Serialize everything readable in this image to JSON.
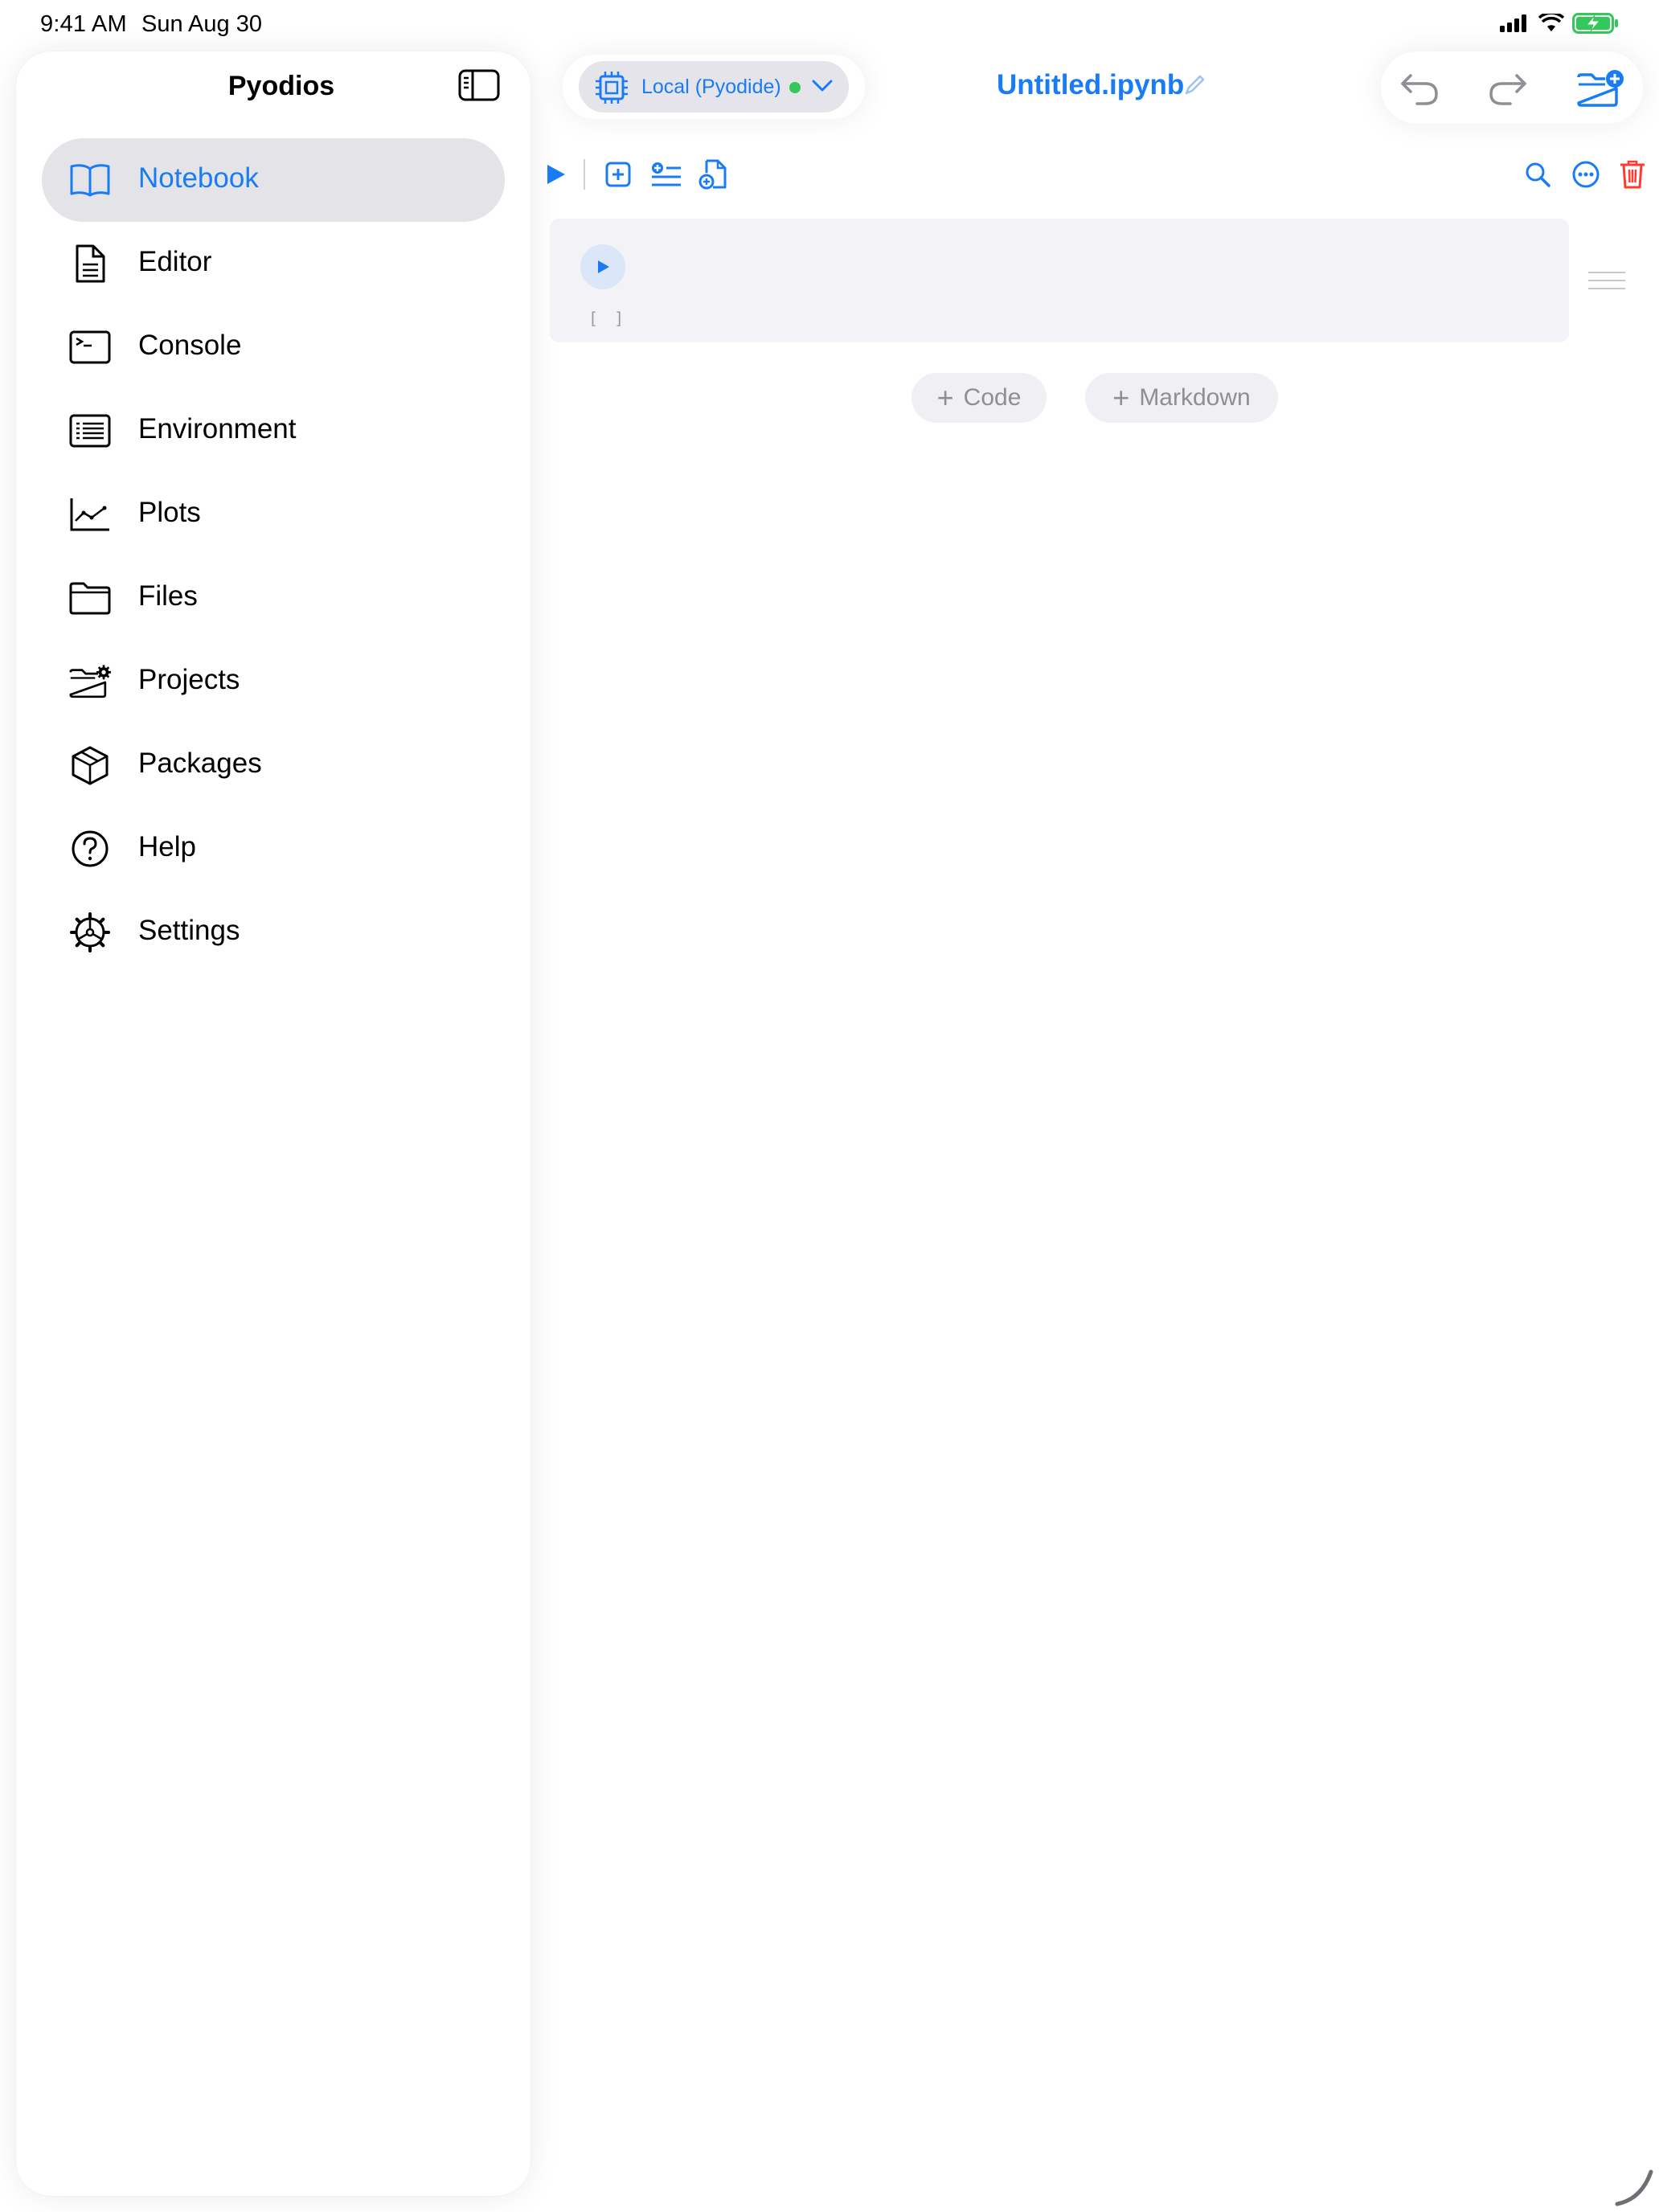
{
  "status_bar": {
    "time": "9:41 AM",
    "date": "Sun Aug 30"
  },
  "sidebar": {
    "title": "Pyodios",
    "items": [
      {
        "label": "Notebook",
        "icon": "book-icon",
        "selected": true
      },
      {
        "label": "Editor",
        "icon": "document-icon",
        "selected": false
      },
      {
        "label": "Console",
        "icon": "terminal-icon",
        "selected": false
      },
      {
        "label": "Environment",
        "icon": "list-icon",
        "selected": false
      },
      {
        "label": "Plots",
        "icon": "chart-icon",
        "selected": false
      },
      {
        "label": "Files",
        "icon": "folder-icon",
        "selected": false
      },
      {
        "label": "Projects",
        "icon": "folder-gear-icon",
        "selected": false
      },
      {
        "label": "Packages",
        "icon": "box-icon",
        "selected": false
      },
      {
        "label": "Help",
        "icon": "question-icon",
        "selected": false
      },
      {
        "label": "Settings",
        "icon": "gear-icon",
        "selected": false
      }
    ]
  },
  "kernel": {
    "label": "Local (Pyodide)",
    "status": "connected",
    "status_color": "#34c759"
  },
  "document": {
    "title": "Untitled.ipynb"
  },
  "notebook": {
    "cells": [
      {
        "execution_count": "[ ]"
      }
    ],
    "add_code_label": "Code",
    "add_markdown_label": "Markdown"
  },
  "colors": {
    "accent": "#1a7cf4",
    "destructive": "#ff3b30",
    "selected_bg": "#e3e3e8"
  }
}
